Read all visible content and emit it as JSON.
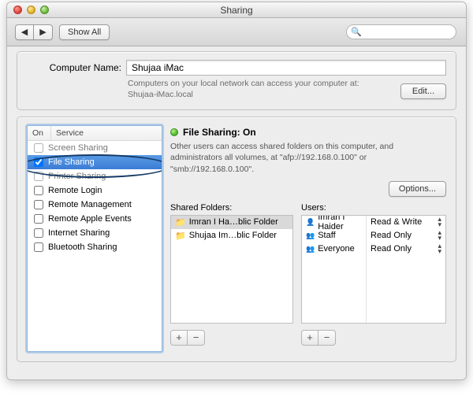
{
  "window": {
    "title": "Sharing"
  },
  "toolbar": {
    "back_icon": "◀",
    "fwd_icon": "▶",
    "show_all": "Show All",
    "search_placeholder": ""
  },
  "computer": {
    "label": "Computer Name:",
    "value": "Shujaa iMac",
    "hint_line1": "Computers on your local network can access your computer at:",
    "hint_line2": "Shujaa-iMac.local",
    "edit": "Edit..."
  },
  "services": {
    "col_on": "On",
    "col_service": "Service",
    "items": [
      {
        "label": "Screen Sharing",
        "on": false,
        "state": "cut-top"
      },
      {
        "label": "File Sharing",
        "on": true,
        "state": "selected"
      },
      {
        "label": "Printer Sharing",
        "on": false,
        "state": "cut-bot"
      },
      {
        "label": "Remote Login",
        "on": false,
        "state": ""
      },
      {
        "label": "Remote Management",
        "on": false,
        "state": ""
      },
      {
        "label": "Remote Apple Events",
        "on": false,
        "state": ""
      },
      {
        "label": "Internet Sharing",
        "on": false,
        "state": ""
      },
      {
        "label": "Bluetooth Sharing",
        "on": false,
        "state": ""
      }
    ]
  },
  "status": {
    "headline": "File Sharing: On",
    "desc": "Other users can access shared folders on this computer, and administrators all volumes, at \"afp://192.168.0.100\" or \"smb://192.168.0.100\"."
  },
  "options_btn": "Options...",
  "folders": {
    "label": "Shared Folders:",
    "items": [
      {
        "name": "Imran I Ha…blic Folder",
        "selected": true
      },
      {
        "name": "Shujaa Im…blic Folder",
        "selected": false
      }
    ]
  },
  "users": {
    "label": "Users:",
    "items": [
      {
        "name": "Imran I Haider",
        "perm": "Read & Write",
        "icon": "single"
      },
      {
        "name": "Staff",
        "perm": "Read Only",
        "icon": "group"
      },
      {
        "name": "Everyone",
        "perm": "Read Only",
        "icon": "group"
      }
    ]
  },
  "glyphs": {
    "plus": "+",
    "minus": "−",
    "search": "🔍",
    "folder": "📁",
    "user1": "👤",
    "users": "👥",
    "up": "▴",
    "down": "▾"
  }
}
